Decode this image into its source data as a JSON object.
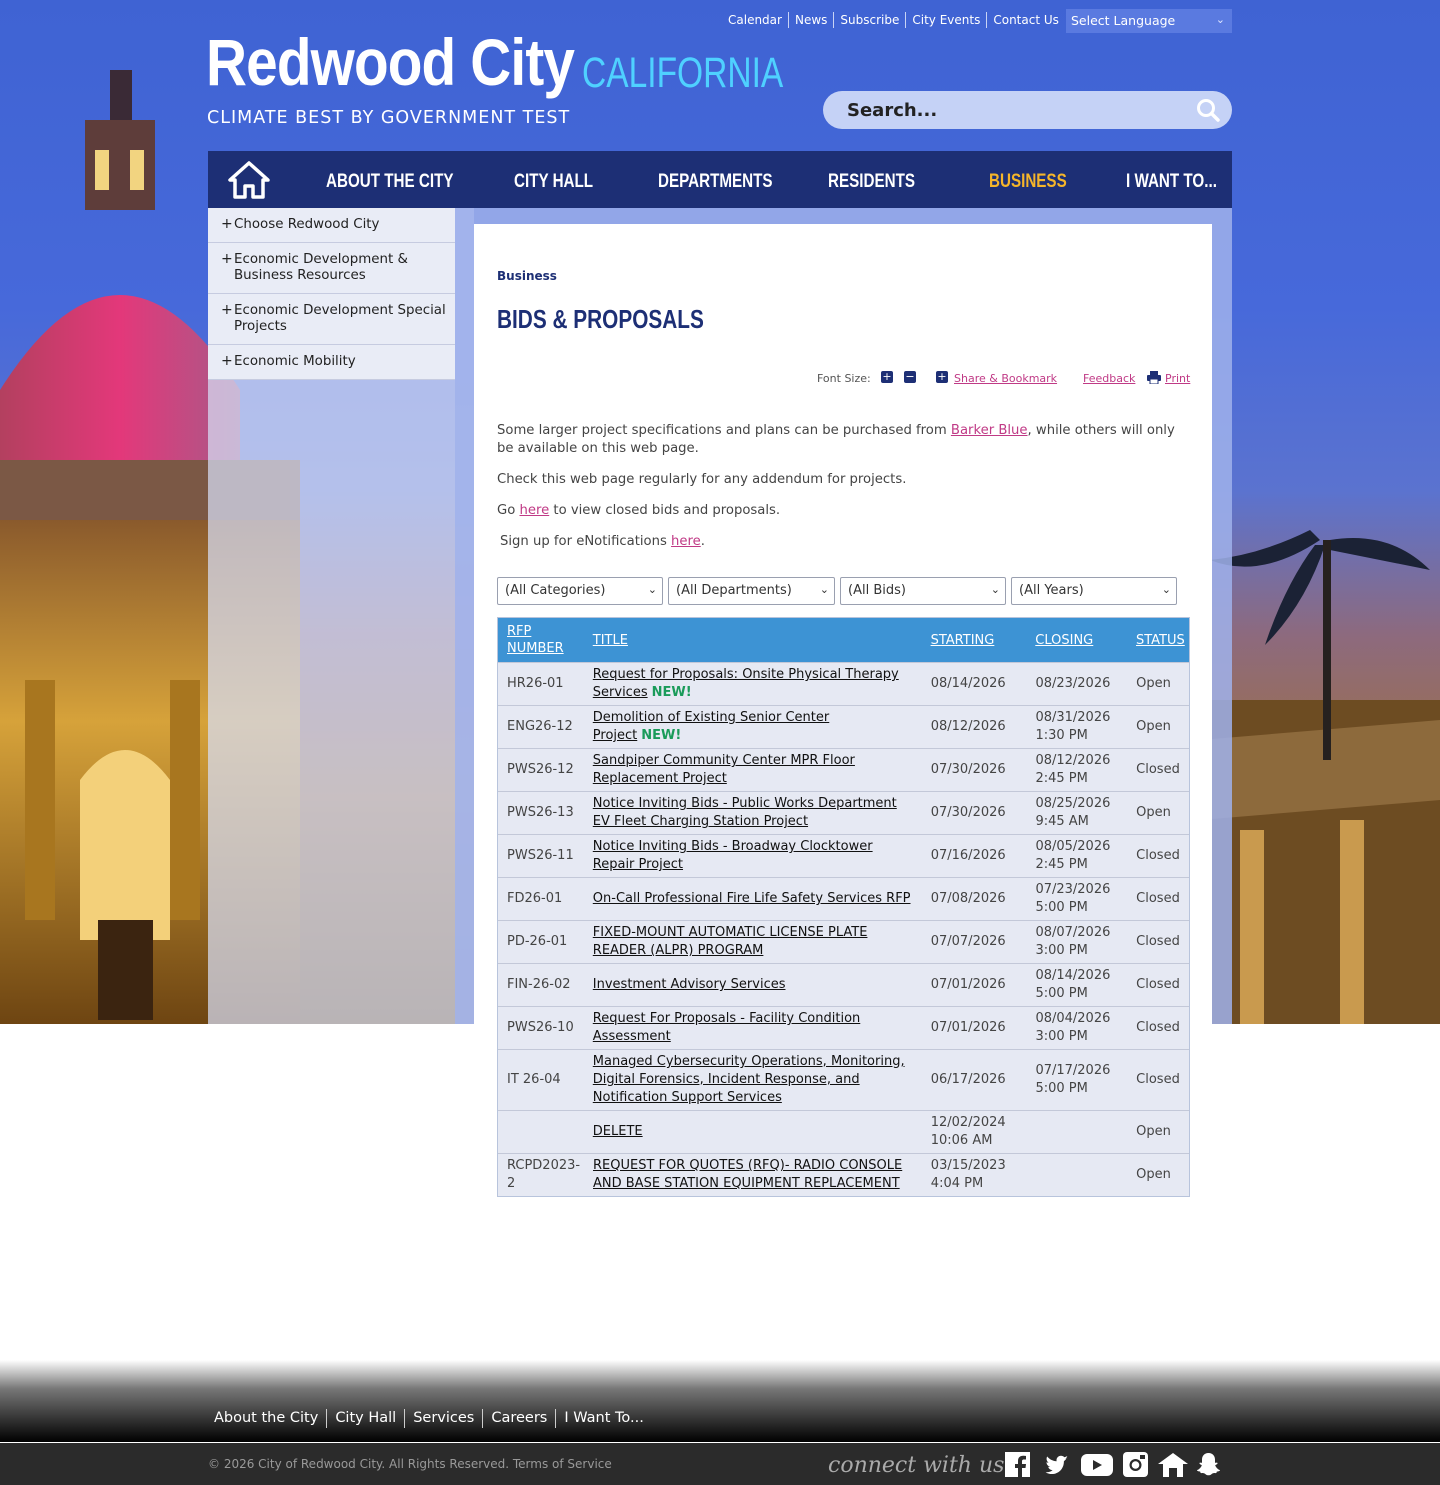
{
  "header": {
    "util_links": [
      "Calendar",
      "News",
      "Subscribe",
      "City Events",
      "Contact Us"
    ],
    "language_select": "Select Language",
    "logo_main": "Redwood City",
    "logo_state": "CALIFORNIA",
    "tagline": "CLIMATE BEST BY GOVERNMENT TEST",
    "search_placeholder": "Search..."
  },
  "nav": {
    "home_icon": "home-icon",
    "items": [
      "ABOUT THE CITY",
      "CITY HALL",
      "DEPARTMENTS",
      "RESIDENTS",
      "BUSINESS",
      "I WANT TO..."
    ],
    "active": "BUSINESS",
    "active_color": "#f5b52a"
  },
  "sidebar": {
    "items": [
      "Choose Redwood City",
      "Economic Development & Business Resources",
      "Economic Development Special Projects",
      "Economic Mobility"
    ]
  },
  "main": {
    "breadcrumb": "Business",
    "title": "BIDS & PROPOSALS",
    "tools": {
      "font_size_label": "Font Size:",
      "share": "Share & Bookmark",
      "feedback": "Feedback",
      "print": "Print"
    },
    "intro": {
      "p1_before": "Some larger project specifications and plans can be purchased from ",
      "p1_link": "Barker Blue",
      "p1_after": ", while others will only be available on this web page.",
      "p2": "Check this web page regularly for any addendum for projects.",
      "p3_before": "Go ",
      "p3_link": "here",
      "p3_after": " to view closed bids and proposals.",
      "p4_before": "Sign up for eNotifications ",
      "p4_link": "here",
      "p4_after": "."
    },
    "filters": [
      "(All Categories)",
      "(All Departments)",
      "(All Bids)",
      "(All Years)"
    ],
    "table": {
      "headers": [
        "RFP NUMBER",
        "TITLE",
        "STARTING",
        "CLOSING",
        "STATUS"
      ],
      "new_label": "NEW!",
      "rows": [
        {
          "rfp": "HR26-01",
          "title": "Request for Proposals: Onsite Physical Therapy Services",
          "new": true,
          "start": "08/14/2026",
          "close": "08/23/2026",
          "status": "Open"
        },
        {
          "rfp": "ENG26-12",
          "title": "Demolition of Existing Senior Center Project",
          "new": true,
          "start": "08/12/2026",
          "close": "08/31/2026 1:30 PM",
          "status": "Open"
        },
        {
          "rfp": "PWS26-12",
          "title": "Sandpiper Community Center MPR Floor Replacement Project",
          "new": false,
          "start": "07/30/2026",
          "close": "08/12/2026 2:45 PM",
          "status": "Closed"
        },
        {
          "rfp": "PWS26-13",
          "title": "Notice Inviting Bids - Public Works Department EV Fleet Charging Station Project",
          "new": false,
          "start": "07/30/2026",
          "close": "08/25/2026 9:45 AM",
          "status": "Open"
        },
        {
          "rfp": "PWS26-11",
          "title": "Notice Inviting Bids - Broadway Clocktower Repair Project",
          "new": false,
          "start": "07/16/2026",
          "close": "08/05/2026 2:45 PM",
          "status": "Closed"
        },
        {
          "rfp": "FD26-01",
          "title": "On-Call Professional Fire Life Safety Services RFP",
          "new": false,
          "start": "07/08/2026",
          "close": "07/23/2026 5:00 PM",
          "status": "Closed"
        },
        {
          "rfp": "PD-26-01",
          "title": "FIXED-MOUNT AUTOMATIC LICENSE PLATE READER (ALPR) PROGRAM",
          "new": false,
          "start": "07/07/2026",
          "close": "08/07/2026 3:00 PM",
          "status": "Closed"
        },
        {
          "rfp": "FIN-26-02",
          "title": "Investment Advisory Services",
          "new": false,
          "start": "07/01/2026",
          "close": "08/14/2026 5:00 PM",
          "status": "Closed"
        },
        {
          "rfp": "PWS26-10",
          "title": "Request For Proposals - Facility Condition Assessment",
          "new": false,
          "start": "07/01/2026",
          "close": "08/04/2026 3:00 PM",
          "status": "Closed"
        },
        {
          "rfp": "IT 26-04",
          "title": "Managed Cybersecurity Operations, Monitoring, Digital Forensics, Incident Response, and Notification Support Services",
          "new": false,
          "start": "06/17/2026",
          "close": "07/17/2026 5:00 PM",
          "status": "Closed"
        },
        {
          "rfp": "",
          "title": "DELETE",
          "new": false,
          "start": "12/02/2024 10:06 AM",
          "close": "",
          "status": "Open"
        },
        {
          "rfp": "RCPD2023-2",
          "title": "REQUEST FOR QUOTES (RFQ)- RADIO CONSOLE AND BASE STATION EQUIPMENT REPLACEMENT",
          "new": false,
          "start": "03/15/2023 4:04 PM",
          "close": "",
          "status": "Open"
        }
      ]
    }
  },
  "footer": {
    "links": [
      "About the City",
      "City Hall",
      "Services",
      "Careers",
      "I Want To..."
    ],
    "copyright": "© 2026 City of Redwood City. All Rights Reserved. Terms of Service",
    "connect": "connect with us",
    "social_icons": [
      "facebook-icon",
      "twitter-icon",
      "youtube-icon",
      "instagram-icon",
      "nextdoor-icon",
      "snapchat-icon"
    ]
  },
  "colors": {
    "brand_blue": "#4168d6",
    "nav_navy": "#1d2f75",
    "table_header": "#3d93d4",
    "link_pink": "#c03a86",
    "new_green": "#1a9b5a"
  }
}
